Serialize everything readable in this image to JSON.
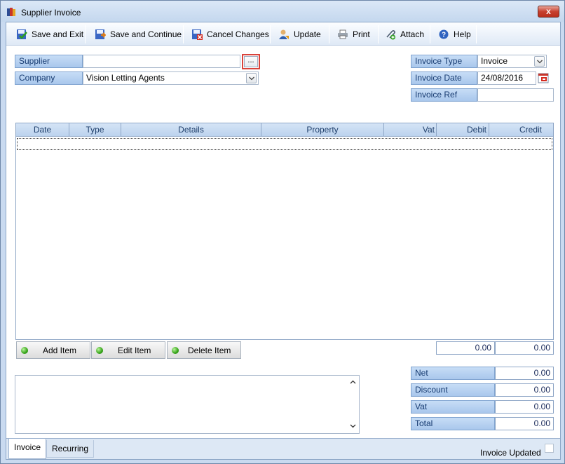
{
  "window": {
    "title": "Supplier Invoice",
    "close_label": "x"
  },
  "toolbar": {
    "save_exit": "Save and Exit",
    "save_continue": "Save and Continue",
    "cancel_changes": "Cancel Changes",
    "update": "Update",
    "print": "Print",
    "attach": "Attach",
    "help": "Help"
  },
  "form": {
    "supplier_label": "Supplier",
    "supplier_value": "",
    "supplier_lookup": "...",
    "company_label": "Company",
    "company_value": "Vision Letting Agents",
    "invoice_type_label": "Invoice Type",
    "invoice_type_value": "Invoice",
    "invoice_date_label": "Invoice Date",
    "invoice_date_value": "24/08/2016",
    "invoice_ref_label": "Invoice Ref",
    "invoice_ref_value": ""
  },
  "grid": {
    "columns": [
      "Date",
      "Type",
      "Details",
      "Property",
      "Vat",
      "Debit",
      "Credit"
    ],
    "rows": []
  },
  "actions": {
    "add": "Add Item",
    "edit": "Edit Item",
    "delete": "Delete Item"
  },
  "totals": {
    "debit": "0.00",
    "credit": "0.00",
    "net_label": "Net",
    "net_value": "0.00",
    "discount_label": "Discount",
    "discount_value": "0.00",
    "vat_label": "Vat",
    "vat_value": "0.00",
    "total_label": "Total",
    "total_value": "0.00"
  },
  "notes": {
    "value": ""
  },
  "tabs": [
    "Invoice",
    "Recurring"
  ],
  "status": {
    "invoice_updated_label": "Invoice Updated",
    "invoice_updated_checked": false
  },
  "colors": {
    "label_bg": "#b5cff0",
    "label_text": "#163a70",
    "accent_red": "#d9433c"
  }
}
